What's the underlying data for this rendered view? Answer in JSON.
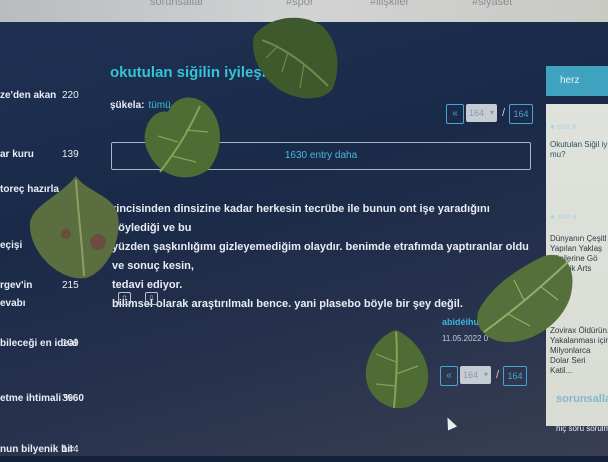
{
  "topbar": {
    "links": [
      "sorunsallar",
      "#spor",
      "#ilişkiler",
      "#siyaset"
    ]
  },
  "sidebar": {
    "items": [
      {
        "label": "ze'den akan",
        "count": "220"
      },
      {
        "label": "ar kuru",
        "count": "139"
      },
      {
        "label": "toreç hazırla",
        "count": ""
      },
      {
        "label": "eçişi",
        "count": ""
      },
      {
        "label": "rgev'in",
        "count": "215"
      },
      {
        "label": "evabı",
        "count": ""
      },
      {
        "label": "bileceği en ideal",
        "count": "109"
      },
      {
        "label": "etme ihtimali %60",
        "count": "39"
      },
      {
        "label": "nun bilyenik bir",
        "count": "144"
      }
    ]
  },
  "topic": {
    "title": "okutulan siğilin iyileşmesi",
    "filter_label": "şükela:",
    "filter_value": "tümü"
  },
  "pager": {
    "prev": "«",
    "current": "164",
    "total": "164"
  },
  "more_entries": "1630 entry daha",
  "entry": {
    "lines": [
      "rincisinden dinsizine kadar herkesin tecrübe ile bunun ont işe yaradığını söylediği ve bu",
      "yüzden şaşkınlığımı gizleyemediğim olaydır. benimde etrafımda yaptıranlar oldu ve sonuç kesin,",
      "tedavi ediyor.",
      "bilimsel olarak araştırılmalı bence. yani plasebo böyle bir şey değil."
    ],
    "author": "abidéihur",
    "date": "11.05.2022 0"
  },
  "right": {
    "header": "herz",
    "q1_sub": "son e",
    "q1_text": "Okutulan Siğil iy mu?",
    "q2_sub": "son e",
    "q2_text": "Dünyanın Çeşitl Yapılan Yaklaş Bilgilerine Gö Zeselik Arts",
    "q3_text": "Zovirax Öldürün. Yakalanması için Milyonlarca Dolar Seri Katil...",
    "sorunsallar_title": "sorunsallar",
    "sorunsallar_text": "hiç soru sorulmam"
  },
  "colors": {
    "accent": "#38c2d6",
    "link": "#46a4d4",
    "background": "#1f3154"
  },
  "icons": [
    "up-arrow-icon",
    "down-arrow-icon",
    "chevron-down-icon",
    "drop-icon",
    "cursor-icon"
  ]
}
